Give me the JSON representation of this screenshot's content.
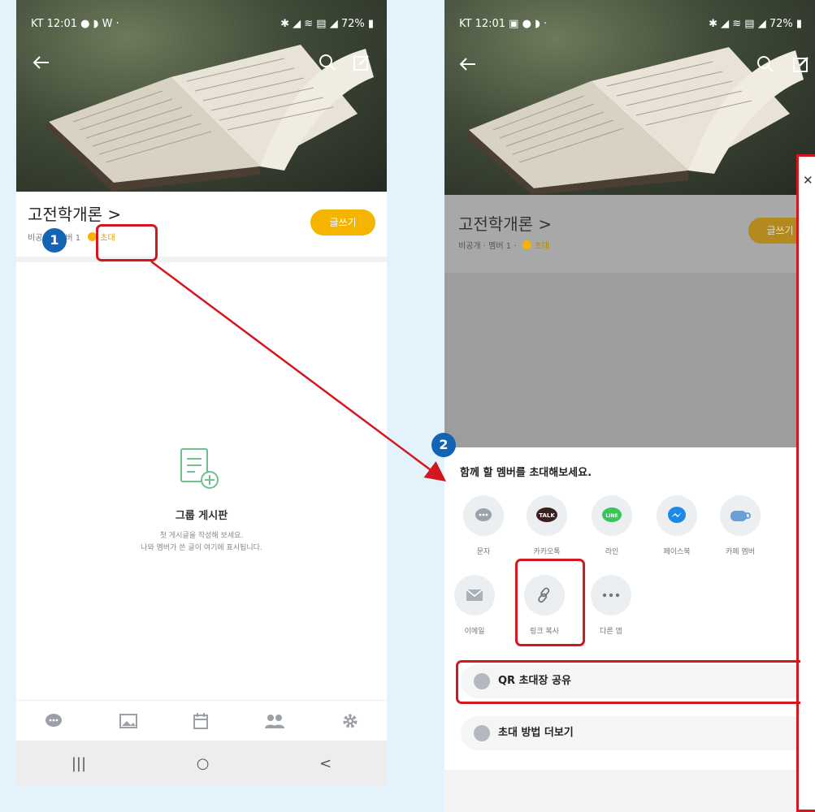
{
  "left": {
    "status": {
      "carrier_time": "KT 12:01 ● ◗ W ·",
      "right": "✱ ◢ ≋ ▤ ◢ 72% ▮"
    },
    "group_title": "고전학개론 >",
    "group_sub": "비공개 · 멤버 1",
    "invite_label": "초대",
    "write_label": "글쓰기",
    "empty_title": "그룹 게시판",
    "empty_line1": "첫 게시글을 작성해 보세요.",
    "empty_line2": "나와 멤버가 쓴 글이 여기에 표시됩니다.",
    "step_badge": "1"
  },
  "right": {
    "status": {
      "carrier_time": "KT 12:01 ▣ ● ◗ ·",
      "right": "✱ ◢ ≋ ▤ ◢ 72% ▮"
    },
    "group_title": "고전학개론 >",
    "group_sub": "비공개 · 멤버 1 ·",
    "invite_label": "초대",
    "write_label": "글쓰기",
    "step_badge": "2",
    "sheet_title": "함께 할 멤버를 초대해보세요.",
    "share_row1": [
      {
        "label": "문자",
        "icon": "sms-icon",
        "color": "#9aa3ad"
      },
      {
        "label": "카카오톡",
        "icon": "kakaotalk-icon",
        "color": "#3b1e1e"
      },
      {
        "label": "라인",
        "icon": "line-icon",
        "color": "#35c757"
      },
      {
        "label": "페이스북",
        "icon": "facebook-messenger-icon",
        "color": "#1e88e5"
      },
      {
        "label": "카페 멤버",
        "icon": "cafe-icon",
        "color": "#6a9fd8"
      }
    ],
    "share_row2": [
      {
        "label": "이메일",
        "icon": "email-icon"
      },
      {
        "label": "링크 복사",
        "icon": "link-icon"
      },
      {
        "label": "다른 앱",
        "icon": "more-dots-icon"
      }
    ],
    "qr_label": "QR 초대장 공유",
    "more_label": "초대 방법 더보기",
    "close_glyph": "✕"
  },
  "colors": {
    "accent": "#f5b400",
    "highlight": "#d3171f",
    "badge": "#1364b5",
    "background": "#e4f2fb"
  }
}
